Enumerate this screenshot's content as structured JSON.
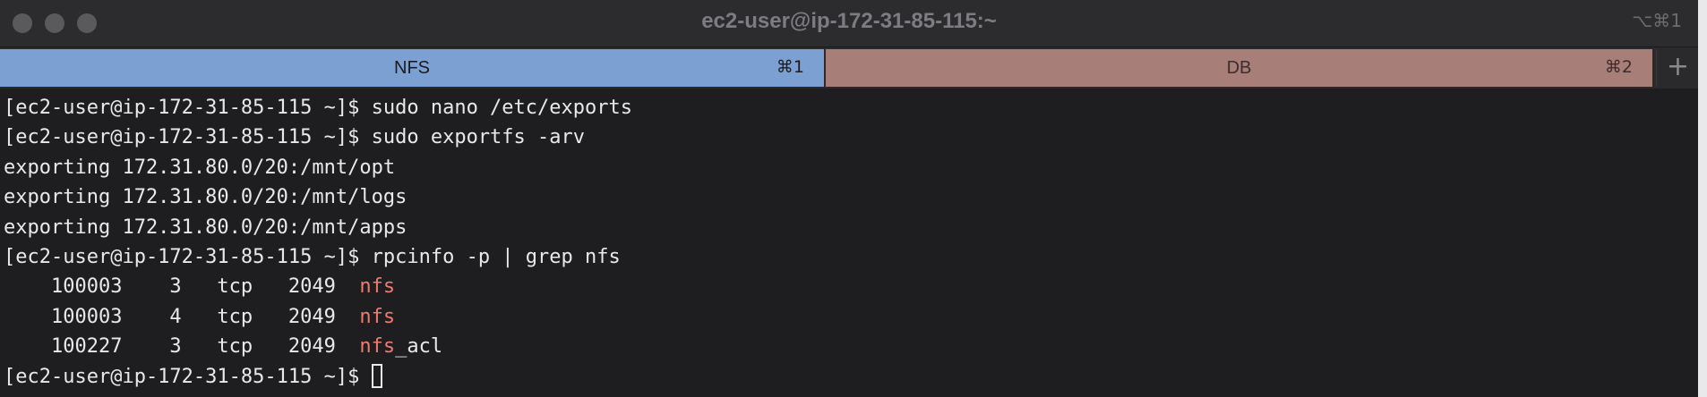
{
  "window": {
    "title": "ec2-user@ip-172-31-85-115:~",
    "shortcut": "⌥⌘1"
  },
  "tabs": [
    {
      "label": "NFS",
      "shortcut": "⌘1",
      "active": true,
      "color": "#7da0d2"
    },
    {
      "label": "DB",
      "shortcut": "⌘2",
      "active": false,
      "color": "#a87e79"
    }
  ],
  "new_tab_icon": "plus-icon",
  "terminal": {
    "prompt": "[ec2-user@ip-172-31-85-115 ~]$ ",
    "highlight_color": "#f07a6e",
    "lines": [
      {
        "type": "command",
        "text": "sudo nano /etc/exports"
      },
      {
        "type": "command",
        "text": "sudo exportfs -arv"
      },
      {
        "type": "output",
        "text": "exporting 172.31.80.0/20:/mnt/opt"
      },
      {
        "type": "output",
        "text": "exporting 172.31.80.0/20:/mnt/logs"
      },
      {
        "type": "output",
        "text": "exporting 172.31.80.0/20:/mnt/apps"
      },
      {
        "type": "command",
        "text": "rpcinfo -p | grep nfs"
      },
      {
        "type": "match",
        "before": "    100003    3   tcp   2049  ",
        "match": "nfs",
        "after": ""
      },
      {
        "type": "match",
        "before": "    100003    4   tcp   2049  ",
        "match": "nfs",
        "after": ""
      },
      {
        "type": "match",
        "before": "    100227    3   tcp   2049  ",
        "match": "nfs",
        "after": "_acl"
      },
      {
        "type": "prompt_cursor",
        "text": ""
      }
    ]
  }
}
